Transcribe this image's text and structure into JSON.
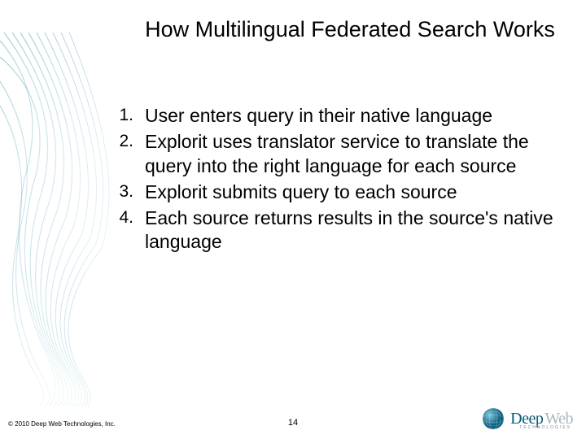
{
  "title": "How Multilingual Federated Search Works",
  "steps": [
    "User enters query in their native language",
    "Explorit uses translator service to translate the query into the right language for each source",
    "Explorit submits query to each source",
    "Each source returns results in the source's native language"
  ],
  "copyright": "© 2010 Deep Web Technologies, Inc.",
  "page_number": "14",
  "logo": {
    "main": "Deep",
    "sub": "Web",
    "tag": "TECHNOLOGIES"
  }
}
